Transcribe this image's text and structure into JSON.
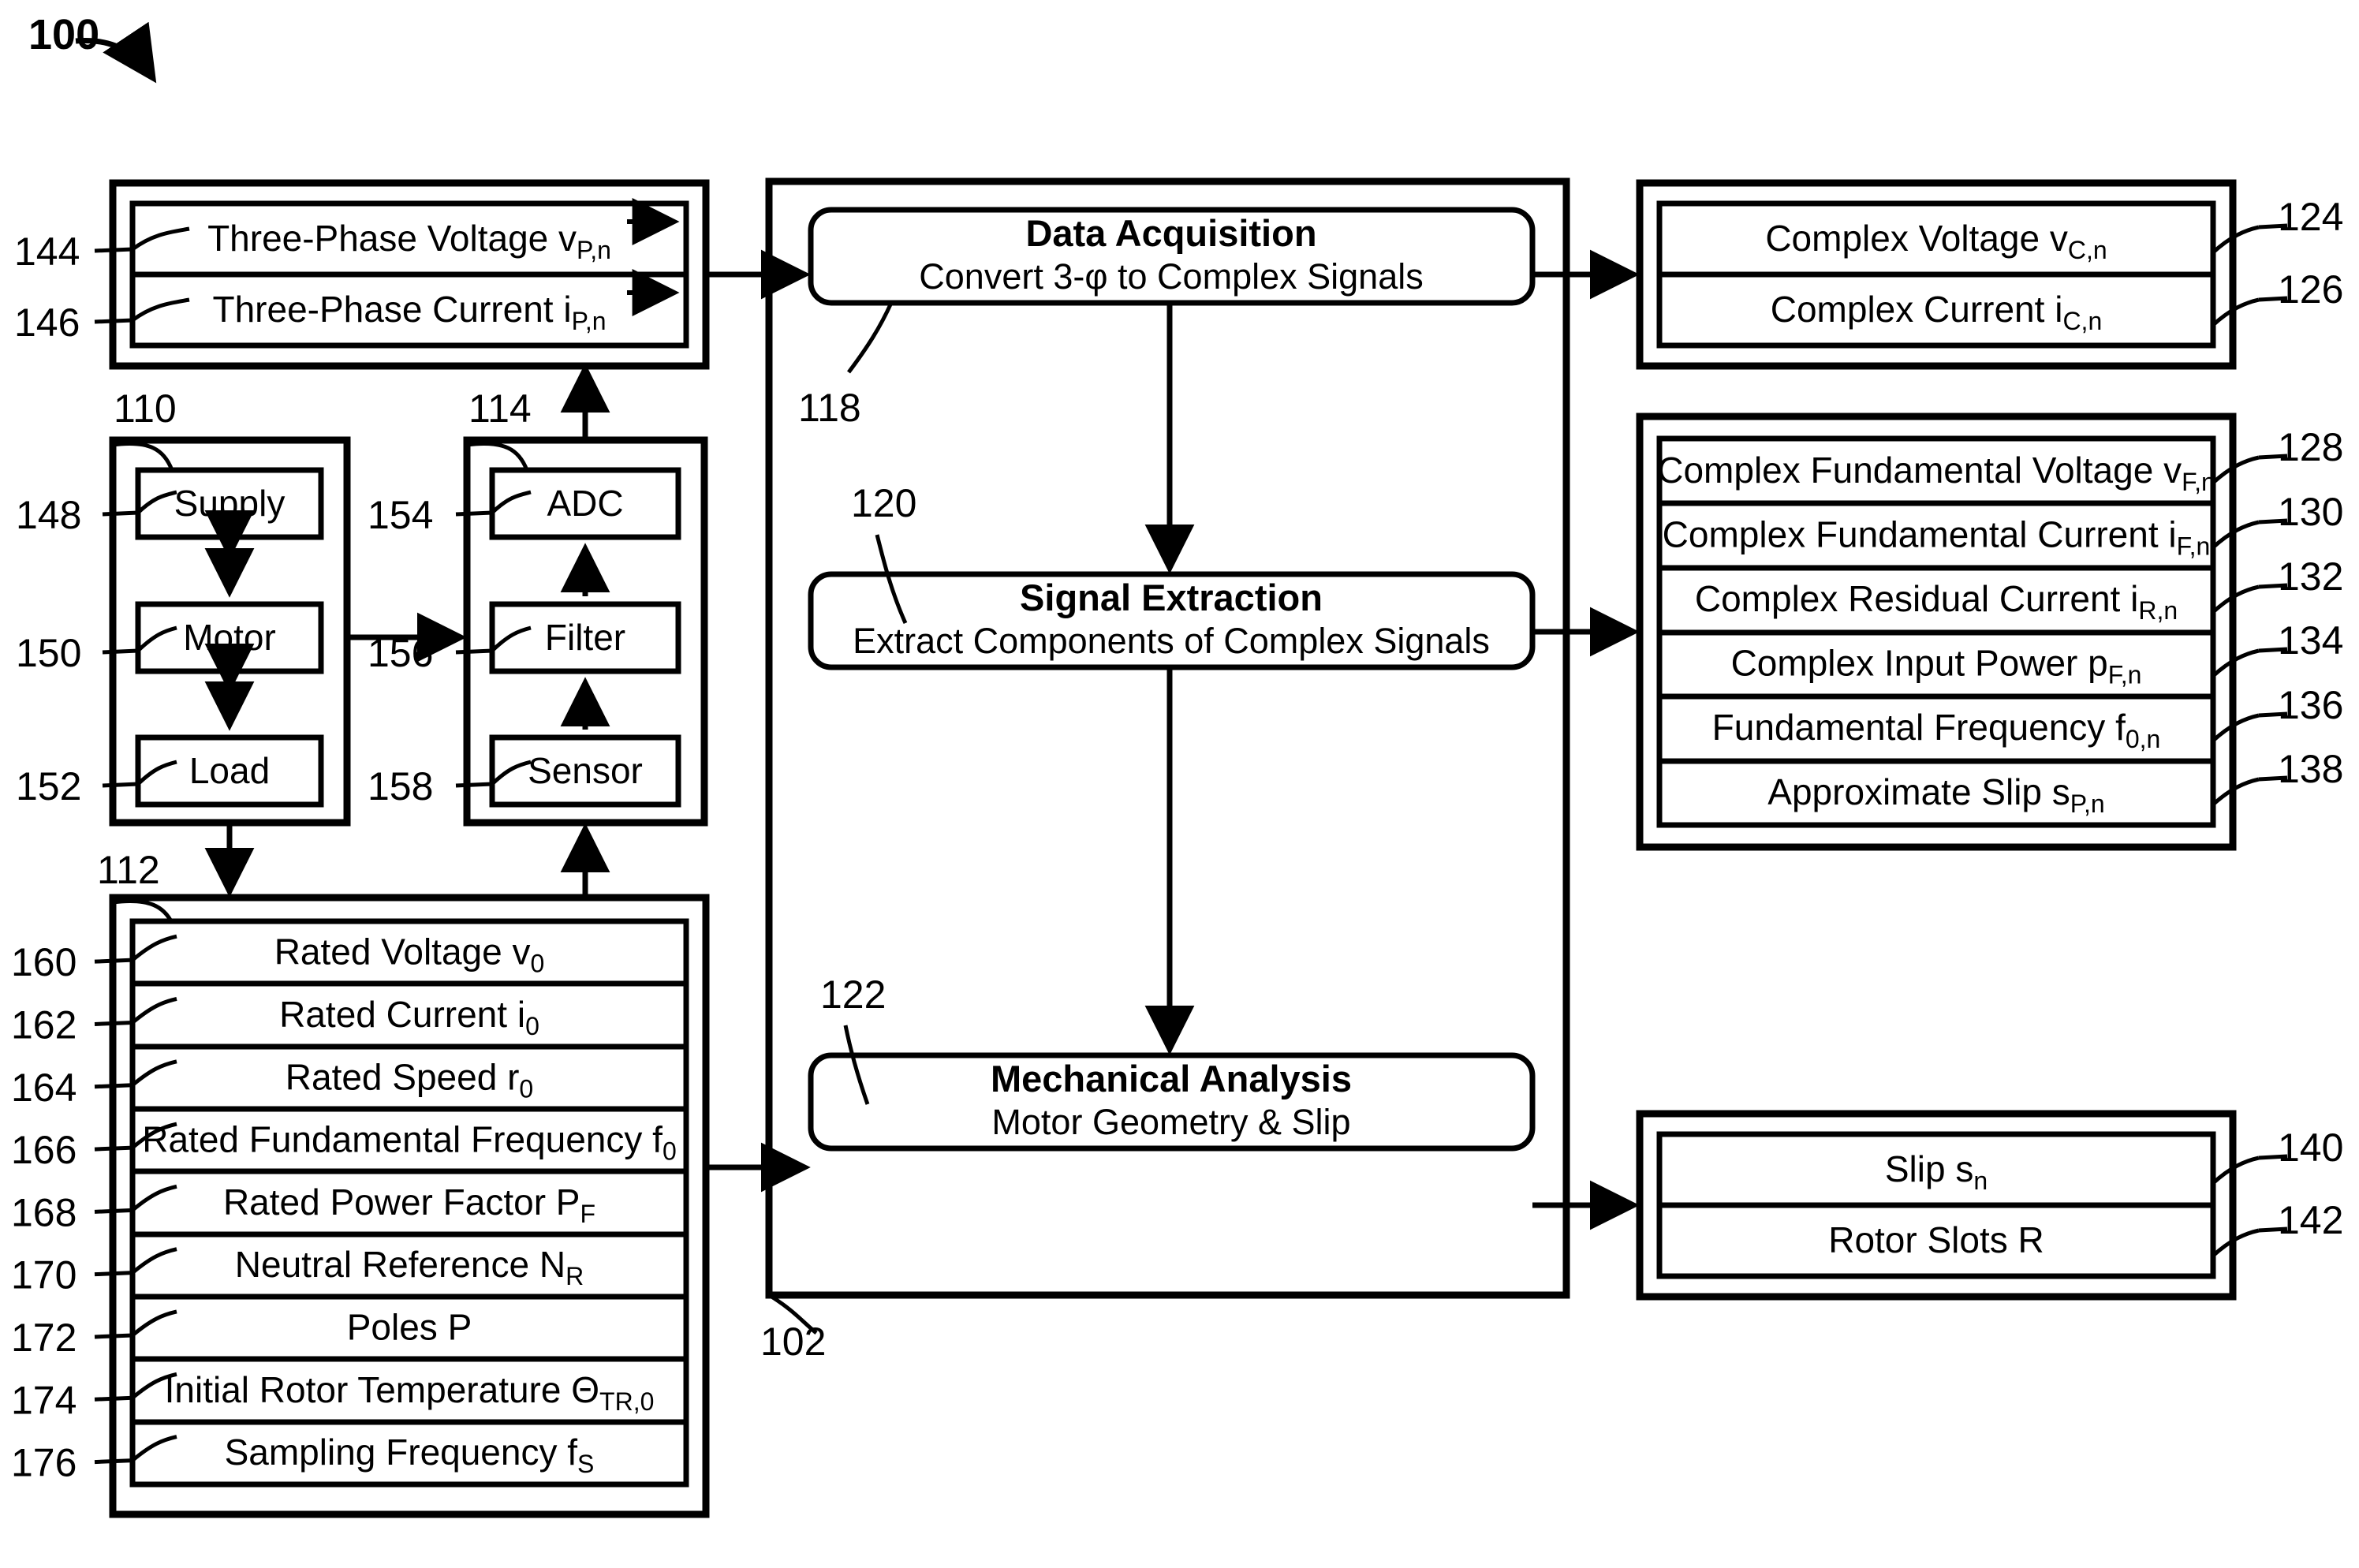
{
  "figure": {
    "number": "100",
    "system_ref": "102"
  },
  "left_inputs": {
    "ref_voltage": "144",
    "ref_current": "146",
    "voltage_label": "Three-Phase Voltage",
    "voltage_symbol": "v",
    "voltage_sub": "P,n",
    "current_label": "Three-Phase Current",
    "current_symbol": "i",
    "current_sub": "P,n"
  },
  "machine_block": {
    "ref": "110",
    "items": [
      {
        "ref": "148",
        "label": "Supply"
      },
      {
        "ref": "150",
        "label": "Motor"
      },
      {
        "ref": "152",
        "label": "Load"
      }
    ]
  },
  "measurement_block": {
    "ref": "114",
    "items": [
      {
        "ref": "154",
        "label": "ADC"
      },
      {
        "ref": "156",
        "label": "Filter"
      },
      {
        "ref": "158",
        "label": "Sensor"
      }
    ]
  },
  "parameters_block": {
    "ref": "112",
    "items": [
      {
        "ref": "160",
        "label": "Rated Voltage",
        "symbol": "v",
        "sub": "0"
      },
      {
        "ref": "162",
        "label": "Rated Current",
        "symbol": "i",
        "sub": "0"
      },
      {
        "ref": "164",
        "label": "Rated Speed",
        "symbol": "r",
        "sub": "0"
      },
      {
        "ref": "166",
        "label": "Rated Fundamental Frequency",
        "symbol": "f",
        "sub": "0"
      },
      {
        "ref": "168",
        "label": "Rated Power Factor",
        "symbol": "P",
        "sub": "F"
      },
      {
        "ref": "170",
        "label": "Neutral Reference",
        "symbol": "N",
        "sub": "R"
      },
      {
        "ref": "172",
        "label": "Poles",
        "symbol": "P",
        "sub": ""
      },
      {
        "ref": "174",
        "label": "Initial Rotor Temperature",
        "symbol": "Θ",
        "sub": "TR,0"
      },
      {
        "ref": "176",
        "label": "Sampling Frequency",
        "symbol": "f",
        "sub": "S"
      }
    ]
  },
  "processes": [
    {
      "ref": "118",
      "title": "Data Acquisition",
      "subtitle": "Convert 3-φ to Complex Signals"
    },
    {
      "ref": "120",
      "title": "Signal Extraction",
      "subtitle": "Extract Components of Complex Signals"
    },
    {
      "ref": "122",
      "title": "Mechanical Analysis",
      "subtitle": "Motor Geometry & Slip"
    }
  ],
  "outputs_complex": {
    "items": [
      {
        "ref": "124",
        "label": "Complex Voltage",
        "symbol": "v",
        "sub": "C,n"
      },
      {
        "ref": "126",
        "label": "Complex Current",
        "symbol": "i",
        "sub": "C,n"
      }
    ]
  },
  "outputs_components": {
    "items": [
      {
        "ref": "128",
        "label": "Complex Fundamental Voltage",
        "symbol": "v",
        "sub": "F,n"
      },
      {
        "ref": "130",
        "label": "Complex Fundamental Current",
        "symbol": "i",
        "sub": "F,n"
      },
      {
        "ref": "132",
        "label": "Complex Residual Current",
        "symbol": "i",
        "sub": "R,n"
      },
      {
        "ref": "134",
        "label": "Complex Input Power",
        "symbol": "p",
        "sub": "F,n"
      },
      {
        "ref": "136",
        "label": "Fundamental Frequency",
        "symbol": "f",
        "sub": "0,n"
      },
      {
        "ref": "138",
        "label": "Approximate Slip",
        "symbol": "s",
        "sub": "P,n"
      }
    ]
  },
  "outputs_mechanical": {
    "items": [
      {
        "ref": "140",
        "label": "Slip",
        "symbol": "s",
        "sub": "n"
      },
      {
        "ref": "142",
        "label": "Rotor Slots",
        "symbol": "R",
        "sub": ""
      }
    ]
  },
  "colors": {
    "line": "#000000",
    "background": "#ffffff"
  }
}
